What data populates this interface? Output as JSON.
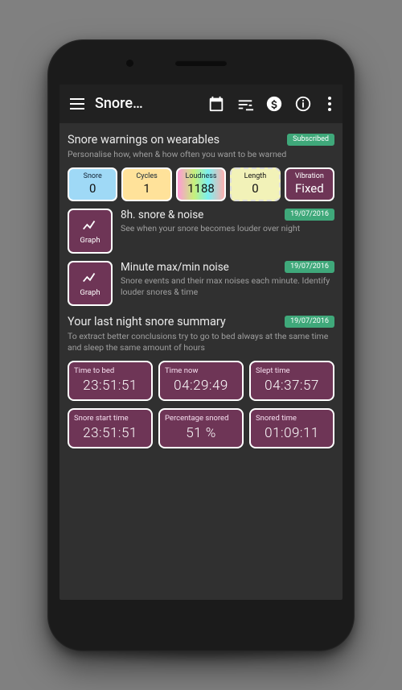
{
  "toolbar": {
    "title": "Snore…"
  },
  "section1": {
    "title": "Snore warnings on wearables",
    "badge": "Subscribed",
    "subtitle": "Personalise how, when & how often you want to be warned"
  },
  "chips": {
    "snore": {
      "label": "Snore",
      "value": "0"
    },
    "cycles": {
      "label": "Cycles",
      "value": "1"
    },
    "loud": {
      "label": "Loudness",
      "value": "1188"
    },
    "length": {
      "label": "Length",
      "value": "0"
    },
    "vibe": {
      "label": "Vibration",
      "value": "Fixed"
    }
  },
  "graph_label": "Graph",
  "graphs": [
    {
      "title": "8h. snore & noise",
      "date": "19/07/2016",
      "sub": "See when your  snore becomes louder over night"
    },
    {
      "title": "Minute max/min noise",
      "date": "19/07/2016",
      "sub": "Snore events and their max noises each minute. Identify louder snores & time"
    }
  ],
  "section2": {
    "title": "Your last night snore summary",
    "date": "19/07/2016",
    "subtitle": "To extract better conclusions try to go to bed always at the same time and sleep the same amount of hours"
  },
  "cards_row1": [
    {
      "label": "Time to bed",
      "value": "23:51:51"
    },
    {
      "label": "Time now",
      "value": "04:29:49"
    },
    {
      "label": "Slept time",
      "value": "04:37:57"
    }
  ],
  "cards_row2": [
    {
      "label": "Snore start time",
      "value": "23:51:51"
    },
    {
      "label": "Percentage snored",
      "value": "51 %"
    },
    {
      "label": "Snored time",
      "value": "01:09:11"
    }
  ]
}
